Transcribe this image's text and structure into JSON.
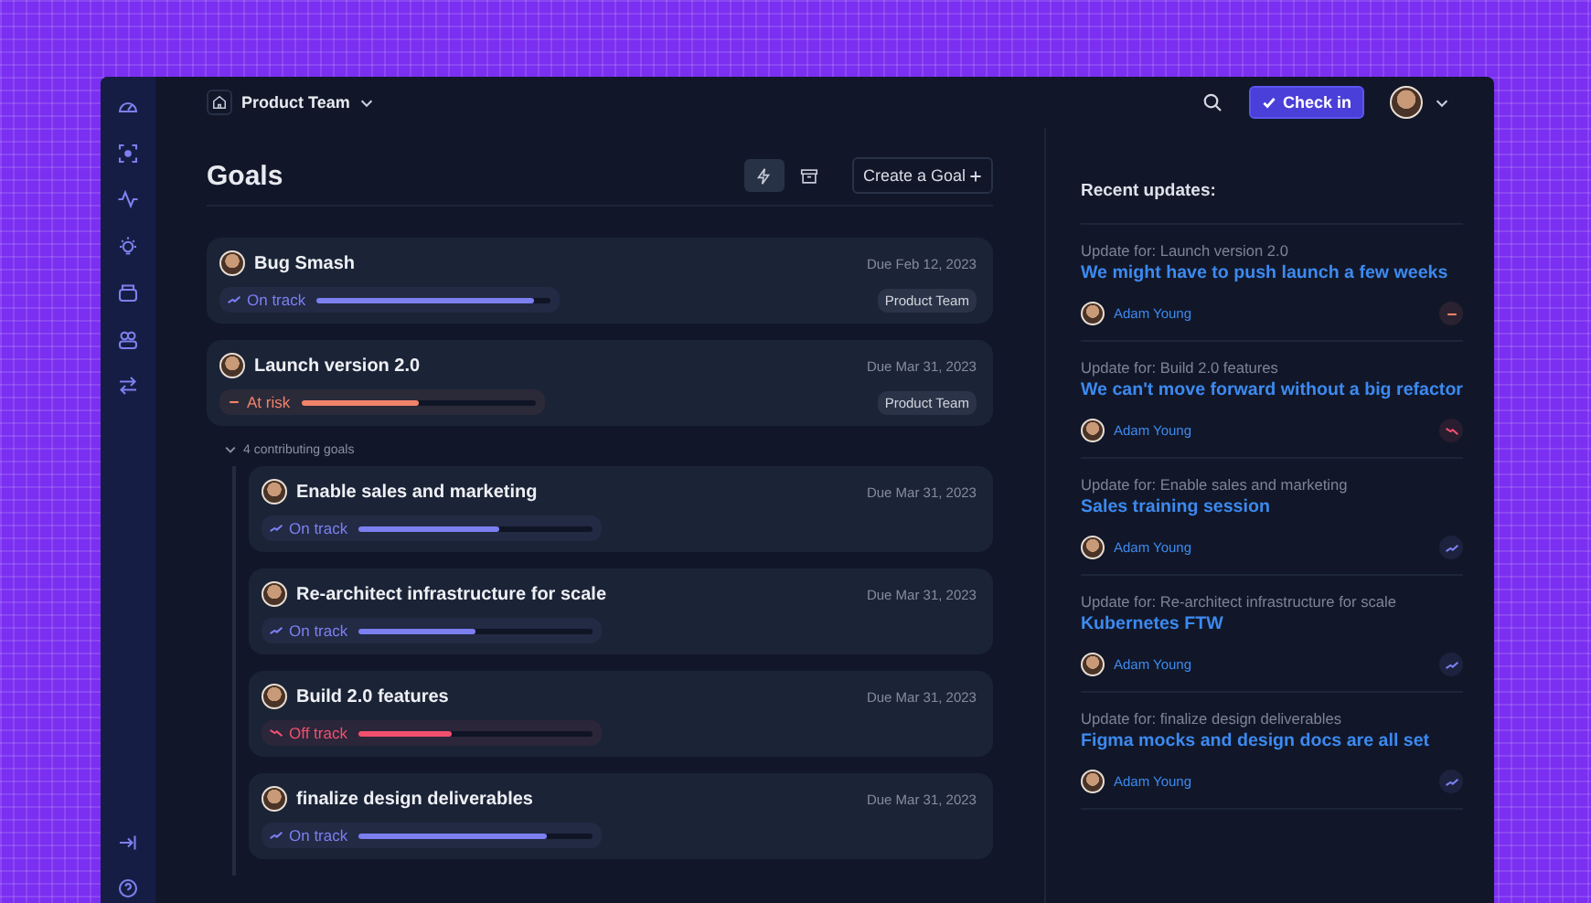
{
  "header": {
    "team": "Product Team",
    "check_in": "Check in"
  },
  "page_title": "Goals",
  "create_button": "Create a Goal",
  "goals": [
    {
      "title": "Bug Smash",
      "due": "Due Feb 12, 2023",
      "status": {
        "kind": "on_track",
        "label": "On track"
      },
      "level": 0.93,
      "tag": "Product Team"
    },
    {
      "title": "Launch version 2.0",
      "due": "Due Mar 31, 2023",
      "status": {
        "kind": "at_risk",
        "label": "At risk"
      },
      "level": 0.5,
      "tag": "Product Team",
      "contributing": {
        "label": "4 contributing goals",
        "expanded": true,
        "goals": [
          {
            "title": "Enable sales and marketing",
            "due": "Due Mar 31, 2023",
            "status": {
              "kind": "on_track",
              "label": "On track"
            },
            "level": 0.6
          },
          {
            "title": "Re-architect infrastructure for scale",
            "due": "Due Mar 31, 2023",
            "status": {
              "kind": "on_track",
              "label": "On track"
            },
            "level": 0.5
          },
          {
            "title": "Build 2.0 features",
            "due": "Due Mar 31, 2023",
            "status": {
              "kind": "off_track",
              "label": "Off track"
            },
            "level": 0.4
          },
          {
            "title": "finalize design deliverables",
            "due": "Due Mar 31, 2023",
            "status": {
              "kind": "on_track",
              "label": "On track"
            },
            "level": 0.8
          }
        ]
      }
    }
  ],
  "updates_title": "Recent updates:",
  "updates": [
    {
      "for": "Update for: Launch version 2.0",
      "headline": "We might have to push launch a few weeks",
      "author": "Adam Young",
      "kind": "at_risk"
    },
    {
      "for": "Update for: Build 2.0 features",
      "headline": "We can't move forward without a big refactor",
      "author": "Adam Young",
      "kind": "off_track"
    },
    {
      "for": "Update for: Enable sales and marketing",
      "headline": "Sales training session",
      "author": "Adam Young",
      "kind": "on_track"
    },
    {
      "for": "Update for: Re-architect infrastructure for scale",
      "headline": "Kubernetes FTW",
      "author": "Adam Young",
      "kind": "on_track"
    },
    {
      "for": "Update for: finalize design deliverables",
      "headline": "Figma mocks and design docs are all set",
      "author": "Adam Young",
      "kind": "on_track"
    }
  ]
}
